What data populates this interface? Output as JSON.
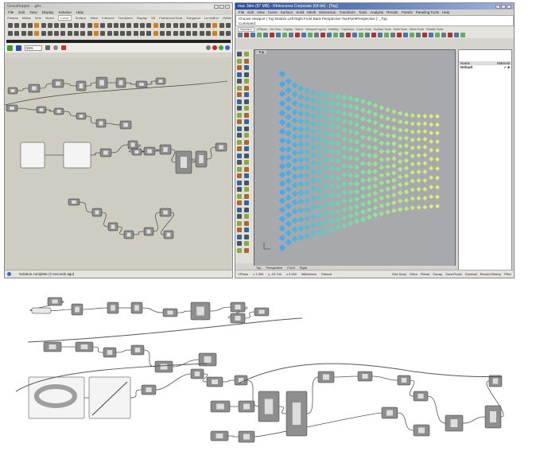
{
  "grasshopper": {
    "title": "Grasshopper - .ghx",
    "menu": [
      "File",
      "Edit",
      "View",
      "Display",
      "Solution",
      "Help"
    ],
    "tabs": [
      "Params",
      "Maths",
      "Sets",
      "Vector",
      "Curve",
      "Surface",
      "Mesh",
      "Intersect",
      "Transform",
      "Display",
      "VB",
      "FrameLessTools",
      "Kangaroo",
      "LunchBox",
      "LMNts"
    ],
    "active_tab": "Curve",
    "zoom": "65%",
    "status": "Solution complete (3 seconds ago)"
  },
  "rhino": {
    "title": "mac 3dm (97 MB) - Rhinoceros Corporate (64-bit) - [Top]",
    "menu": [
      "File",
      "Edit",
      "View",
      "Curve",
      "Surface",
      "Solid",
      "Mesh",
      "Dimension",
      "Transform",
      "Tools",
      "Analysis",
      "Render",
      "Panels",
      "Paneling Tools",
      "Help"
    ],
    "command_history": "Choose viewport ( Top Bottom Left Right Front Back Perspective TwoPointPerspective ): _Top",
    "command_prompt": "Command:",
    "tabs": [
      "Standard",
      "CPlanes",
      "Set View",
      "Display",
      "Select",
      "Viewport Layout",
      "Visibility",
      "Transform",
      "Curve Tools",
      "Surface Tools",
      "Solid Tools",
      "Mesh Tools",
      "Render Tools"
    ],
    "viewport_label": "Top",
    "viewport_tabs": [
      "Top",
      "Perspective",
      "Front",
      "Right"
    ],
    "status": {
      "cplane": "CPlane",
      "x": "x 1.359",
      "y": "y -23.740",
      "z": "z 0.000",
      "units": "Millimeters",
      "layer": "Default",
      "toggles": [
        "Grid Snap",
        "Ortho",
        "Planar",
        "Osnap",
        "SmartTrack",
        "Gumball",
        "Record History",
        "Filter"
      ]
    },
    "layers": {
      "col_name": "Name",
      "col_material": "Material",
      "row": "Default"
    },
    "colors": {
      "viewport": "#a7a9ad",
      "grid_start": "#4aa8e8",
      "grid_mid": "#7ee0a0",
      "grid_end": "#e8f070"
    }
  }
}
